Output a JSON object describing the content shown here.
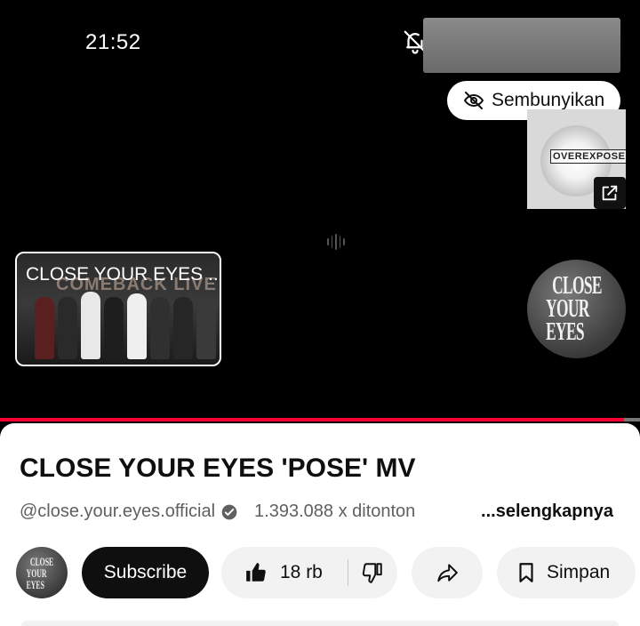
{
  "status_bar": {
    "time": "21:52"
  },
  "player": {
    "hide_label": "Sembunyikan",
    "promo_label": "OVEREXPOSED",
    "clip_card_title": "CLOSE YOUR EYES ...",
    "clip_card_bg_text": "COMEBACK LIVE",
    "channel_disc_line1": "CLOSE",
    "channel_disc_line2": "YOUR EYES",
    "progress_fraction": 0.975
  },
  "video": {
    "title": "CLOSE YOUR EYES 'POSE' MV",
    "channel_handle": "@close.your.eyes.official",
    "views": "1.393.088 x ditonton",
    "more_label": "...selengkapnya"
  },
  "actions": {
    "avatar_text_1": "CLOSE",
    "avatar_text_2": "YOUR EYES",
    "subscribe_label": "Subscribe",
    "like_count": "18 rb",
    "save_label": "Simpan"
  },
  "colors": {
    "accent_red": "#ff0033",
    "subscribe_bg": "#0f0f0f",
    "pill_bg": "#f2f2f2"
  }
}
